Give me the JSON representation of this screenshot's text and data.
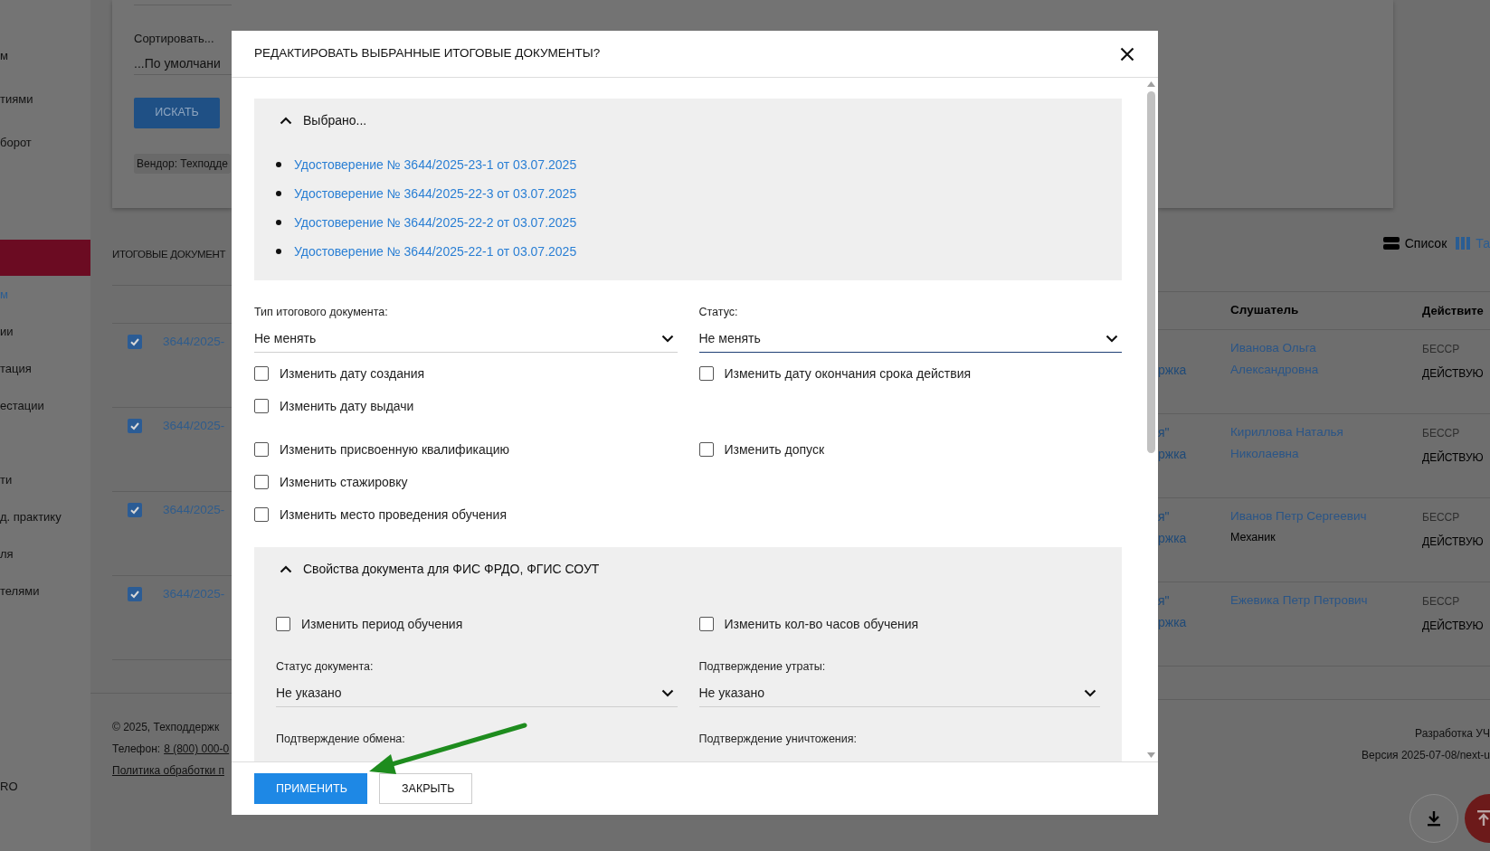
{
  "sidebar": {
    "items": [
      {
        "kind": "item",
        "label": "м",
        "selected": false
      },
      {
        "kind": "item",
        "label": "тиями",
        "selected": false
      },
      {
        "kind": "item",
        "label": "борот",
        "selected": false
      },
      {
        "kind": "group",
        "selected": true
      },
      {
        "kind": "item",
        "label": "м",
        "selected": true
      },
      {
        "kind": "item",
        "label": "ии",
        "selected": false
      },
      {
        "kind": "item",
        "label": "тация",
        "selected": false
      },
      {
        "kind": "item",
        "label": "естации",
        "selected": false
      },
      {
        "kind": "spacer"
      },
      {
        "kind": "item",
        "label": "ти",
        "selected": false
      },
      {
        "kind": "item",
        "label": "д. практику",
        "selected": false
      },
      {
        "kind": "item",
        "label": "ля",
        "selected": false
      },
      {
        "kind": "item",
        "label": "телями",
        "selected": false
      }
    ],
    "bottom_label": "RO"
  },
  "filter": {
    "sort_label": "Сортировать...",
    "sort_value": "...По умолчани",
    "search_button": "ИСКАТЬ",
    "chip": "Вендор: Техподде"
  },
  "documents": {
    "title": "ИТОГОВЫЕ ДОКУМЕНТ",
    "view_options": [
      {
        "label": "Список",
        "kind": "list",
        "selected": false
      },
      {
        "label": "Та",
        "kind": "table",
        "selected": true
      }
    ]
  },
  "table": {
    "columns": [
      {
        "label": "Слушатель"
      },
      {
        "label": "Действите"
      }
    ],
    "rows": [
      {
        "checked": true,
        "number": "3644/2025-",
        "column_1": {
          "line_2": "ржка"
        },
        "listener": "Иванова Ольга Александровна",
        "validity": "БЕССР",
        "status": "ДЕЙСТВУЮ"
      },
      {
        "checked": true,
        "number": "3644/2025-",
        "column_1": {
          "line_1": "я\"",
          "line_2": "ржка"
        },
        "listener": "Кириллова Наталья Николаевна",
        "validity": "БЕССР",
        "status": "ДЕЙСТВУЮ"
      },
      {
        "checked": true,
        "number": "3644/2025-",
        "column_1": {
          "line_1": "я\"",
          "line_2": "ржка"
        },
        "listener": "Иванов Петр Сергеевич",
        "listener_note": "Механик",
        "validity": "БЕССР",
        "status": "ДЕЙСТВУЮ"
      },
      {
        "checked": true,
        "number": "3644/2025-",
        "column_1": {
          "line_1": "я\"",
          "line_2": "ржка"
        },
        "listener": "Ежевика Петр Петрович",
        "validity": "БЕССР",
        "status": "ДЕЙСТВУЮ"
      }
    ]
  },
  "footer": {
    "copyright": "©  2025, Техподдержк",
    "phone_label": "Телефон:",
    "phone": "8 (800) 000-0",
    "policy": "Политика обработки п",
    "developer": "Разработка УЧ",
    "version": "Версия 2025-07-08/next-u"
  },
  "modal": {
    "title": "РЕДАКТИРОВАТЬ ВЫБРАННЫЕ ИТОГОВЫЕ ДОКУМЕНТЫ?",
    "selected_panel": {
      "title": "Выбрано...",
      "expanded": true,
      "items": [
        "Удостоверение № 3644/2025-23-1 от 03.07.2025",
        "Удостоверение № 3644/2025-22-3 от 03.07.2025",
        "Удостоверение № 3644/2025-22-2 от 03.07.2025",
        "Удостоверение № 3644/2025-22-1 от 03.07.2025"
      ]
    },
    "fields": [
      {
        "label": "Тип итогового документа:",
        "value": "Не менять",
        "focused": false
      },
      {
        "label": "Статус:",
        "value": "Не менять",
        "focused": true
      }
    ],
    "option_groups": [
      {
        "rows": [
          {
            "left": {
              "label": "Изменить дату создания",
              "checked": false
            },
            "right": {
              "label": "Изменить дату окончания срока действия",
              "checked": false
            }
          },
          {
            "left": {
              "label": "Изменить дату выдачи",
              "checked": false
            }
          }
        ]
      },
      {
        "rows": [
          {
            "left": {
              "label": "Изменить присвоенную квалификацию",
              "checked": false
            },
            "right": {
              "label": "Изменить допуск",
              "checked": false
            }
          },
          {
            "left": {
              "label": "Изменить стажировку",
              "checked": false
            }
          },
          {
            "left": {
              "label": "Изменить место проведения обучения",
              "checked": false
            }
          }
        ]
      }
    ],
    "fis_panel": {
      "title": "Свойства документа для ФИС ФРДО, ФГИС СОУТ",
      "expanded": true,
      "options": [
        {
          "label": "Изменить период обучения",
          "checked": false
        },
        {
          "label": "Изменить кол-во часов обучения",
          "checked": false
        }
      ],
      "fields": [
        {
          "label": "Статус документа:",
          "value": "Не указано"
        },
        {
          "label": "Подтверждение утраты:",
          "value": "Не указано"
        },
        {
          "label": "Подтверждение обмена:"
        },
        {
          "label": "Подтверждение уничтожения:"
        }
      ]
    },
    "buttons": [
      {
        "label": "ПРИМЕНИТЬ",
        "kind": "primary"
      },
      {
        "label": "ЗАКРЫТЬ",
        "kind": "secondary"
      }
    ]
  }
}
